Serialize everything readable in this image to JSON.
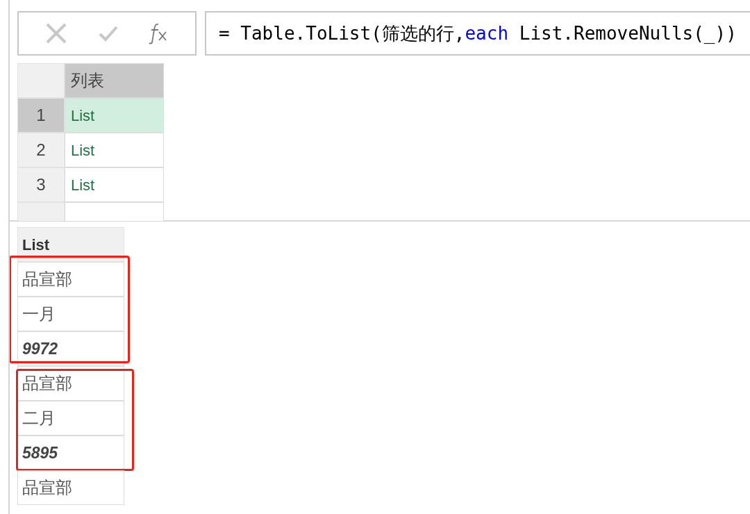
{
  "formula_bar": {
    "formula": [
      {
        "kind": "plain",
        "text": "= Table.ToList(筛选的行,"
      },
      {
        "kind": "keyword",
        "text": "each"
      },
      {
        "kind": "plain",
        "text": " List.RemoveNulls(_))"
      }
    ]
  },
  "preview_table": {
    "columns": [
      "列表"
    ],
    "rows": [
      {
        "number": "1",
        "value": "List",
        "selected": true
      },
      {
        "number": "2",
        "value": "List",
        "selected": false
      },
      {
        "number": "3",
        "value": "List",
        "selected": false
      }
    ]
  },
  "list_view": {
    "header": "List",
    "groups": [
      {
        "highlighted": true,
        "items": [
          {
            "kind": "text",
            "value": "品宣部"
          },
          {
            "kind": "text",
            "value": "一月"
          },
          {
            "kind": "number",
            "value": "9972"
          }
        ]
      },
      {
        "highlighted": true,
        "items": [
          {
            "kind": "text",
            "value": "品宣部"
          },
          {
            "kind": "text",
            "value": "二月"
          },
          {
            "kind": "number",
            "value": "5895"
          }
        ]
      },
      {
        "highlighted": false,
        "items": [
          {
            "kind": "text",
            "value": "品宣部"
          }
        ]
      }
    ]
  }
}
